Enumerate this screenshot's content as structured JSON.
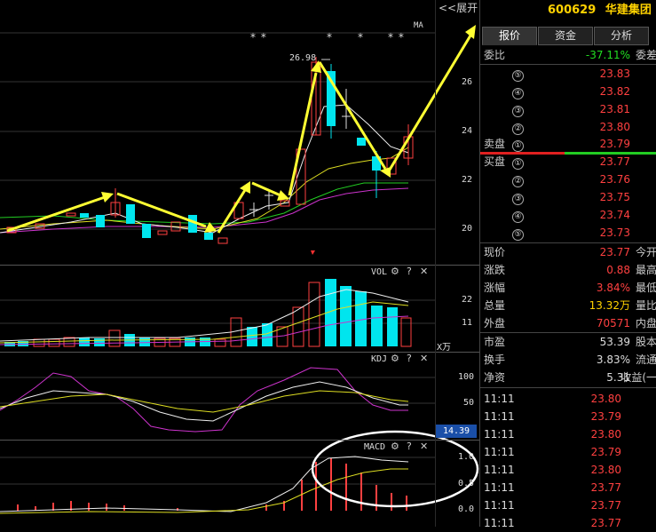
{
  "toolbar": {
    "expand_label": "<<展开",
    "ma_label": "MA"
  },
  "main_axis": {
    "labels": [
      "26",
      "24",
      "22",
      "20"
    ]
  },
  "annotation": {
    "high_price": "26.98"
  },
  "stars": [
    "* *",
    "*",
    "*",
    "* *"
  ],
  "vol_panel": {
    "tag": "VOL",
    "axis": [
      "22",
      "11"
    ],
    "unit": "X万"
  },
  "kdj_panel": {
    "tag": "KDJ",
    "axis": [
      "100",
      "50"
    ],
    "badge": "14.39"
  },
  "macd_panel": {
    "tag": "MACD",
    "axis": [
      "1.0",
      "0.5",
      "0.0"
    ]
  },
  "tools": {
    "gear": "⚙",
    "help": "?",
    "close": "✕"
  },
  "stock": {
    "code": "600629",
    "name": "华建集团"
  },
  "tabs": [
    "报价",
    "资金",
    "分析"
  ],
  "weibi": {
    "label": "委比",
    "value": "-37.11%",
    "label2": "委差"
  },
  "asks": [
    {
      "n": "⑤",
      "price": "23.83"
    },
    {
      "n": "④",
      "price": "23.82"
    },
    {
      "n": "③",
      "price": "23.81"
    },
    {
      "n": "②",
      "price": "23.80"
    },
    {
      "n": "①",
      "price": "23.79",
      "label": "卖盘"
    }
  ],
  "bids": [
    {
      "n": "①",
      "price": "23.77",
      "label": "买盘"
    },
    {
      "n": "②",
      "price": "23.76"
    },
    {
      "n": "③",
      "price": "23.75"
    },
    {
      "n": "④",
      "price": "23.74"
    },
    {
      "n": "⑤",
      "price": "23.73"
    }
  ],
  "quote": [
    {
      "label": "现价",
      "value": "23.77",
      "color": "red",
      "label2": "今开"
    },
    {
      "label": "涨跌",
      "value": "0.88",
      "color": "red",
      "label2": "最高"
    },
    {
      "label": "涨幅",
      "value": "3.84%",
      "color": "red",
      "label2": "最低"
    },
    {
      "label": "总量",
      "value": "13.32万",
      "color": "yellow",
      "label2": "量比"
    },
    {
      "label": "外盘",
      "value": "70571",
      "color": "red",
      "label2": "内盘"
    }
  ],
  "fundamentals": [
    {
      "label": "市盈",
      "value": "53.39",
      "label2": "股本"
    },
    {
      "label": "换手",
      "value": "3.83%",
      "label2": "流通"
    },
    {
      "label": "净资",
      "value": "5.31",
      "label2": "收益(一"
    }
  ],
  "ticks": [
    {
      "time": "11:11",
      "price": "23.80"
    },
    {
      "time": "11:11",
      "price": "23.79"
    },
    {
      "time": "11:11",
      "price": "23.80"
    },
    {
      "time": "11:11",
      "price": "23.79"
    },
    {
      "time": "11:11",
      "price": "23.80"
    },
    {
      "time": "11:11",
      "price": "23.77"
    },
    {
      "time": "11:11",
      "price": "23.77"
    },
    {
      "time": "11:11",
      "price": "23.77"
    }
  ],
  "colors": {
    "up": "#ff4040",
    "down": "#00e5ee",
    "accent": "#ffd200",
    "arrow": "#ffff33"
  }
}
